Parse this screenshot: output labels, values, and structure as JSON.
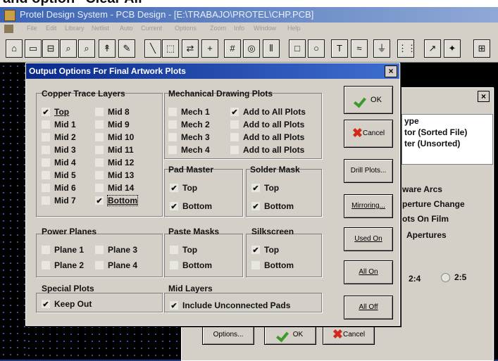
{
  "caption": "and option \"Clear All\"",
  "app": {
    "title": "Protel Design System - PCB Design - [E:\\TRABAJO\\PROTEL\\CHP.PCB]",
    "menu": [
      "File",
      "Edit",
      "Library",
      "Netlist",
      "Auto",
      "Current",
      "Options",
      "Zoom",
      "Info",
      "Window",
      "Help"
    ],
    "toolbar_glyphs": [
      "⌂",
      "▭",
      "⊟",
      "⌕",
      "⌕",
      "↟",
      "✎",
      "╲",
      "⬚",
      "⇄",
      "+",
      "#",
      "◎",
      "⦀",
      "□",
      "○",
      "T",
      "≈",
      "⏚",
      "⋮⋮",
      "↗",
      "✦",
      "⊞"
    ]
  },
  "dialog": {
    "title": "Output Options For Final Artwork Plots",
    "close": "×",
    "copper": {
      "title": "Copper Trace Layers",
      "left": [
        {
          "label": "Top",
          "checked": true
        },
        {
          "label": "Mid 1",
          "checked": false
        },
        {
          "label": "Mid 2",
          "checked": false
        },
        {
          "label": "Mid 3",
          "checked": false
        },
        {
          "label": "Mid 4",
          "checked": false
        },
        {
          "label": "Mid 5",
          "checked": false
        },
        {
          "label": "Mid 6",
          "checked": false
        },
        {
          "label": "Mid 7",
          "checked": false
        }
      ],
      "right": [
        {
          "label": "Mid 8",
          "checked": false
        },
        {
          "label": "Mid 9",
          "checked": false
        },
        {
          "label": "Mid 10",
          "checked": false
        },
        {
          "label": "Mid 11",
          "checked": false
        },
        {
          "label": "Mid 12",
          "checked": false
        },
        {
          "label": "Mid 13",
          "checked": false
        },
        {
          "label": "Mid 14",
          "checked": false
        },
        {
          "label": "Bottom",
          "checked": true
        }
      ]
    },
    "mechanical": {
      "title": "Mechanical Drawing Plots",
      "rows": [
        {
          "mech": "Mech 1",
          "mech_checked": false,
          "add": "Add to All Plots",
          "add_checked": true
        },
        {
          "mech": "Mech 2",
          "mech_checked": false,
          "add": "Add to all Plots",
          "add_checked": false
        },
        {
          "mech": "Mech 3",
          "mech_checked": false,
          "add": "Add to all Plots",
          "add_checked": false
        },
        {
          "mech": "Mech 4",
          "mech_checked": false,
          "add": "Add to all Plots",
          "add_checked": false
        }
      ]
    },
    "pad_master": {
      "title": "Pad Master",
      "items": [
        {
          "label": "Top",
          "checked": true
        },
        {
          "label": "Bottom",
          "checked": true
        }
      ]
    },
    "solder_mask": {
      "title": "Solder Mask",
      "items": [
        {
          "label": "Top",
          "checked": true
        },
        {
          "label": "Bottom",
          "checked": true
        }
      ]
    },
    "power_planes": {
      "title": "Power Planes",
      "items": [
        {
          "label": "Plane 1",
          "checked": false
        },
        {
          "label": "Plane 3",
          "checked": false
        },
        {
          "label": "Plane 2",
          "checked": false
        },
        {
          "label": "Plane 4",
          "checked": false
        }
      ]
    },
    "paste_masks": {
      "title": "Paste Masks",
      "items": [
        {
          "label": "Top",
          "checked": false
        },
        {
          "label": "Bottom",
          "checked": false
        }
      ]
    },
    "silkscreen": {
      "title": "Silkscreen",
      "items": [
        {
          "label": "Top",
          "checked": true
        },
        {
          "label": "Bottom",
          "checked": false
        }
      ]
    },
    "special": {
      "title": "Special Plots",
      "items": [
        {
          "label": "Keep Out",
          "checked": true
        }
      ]
    },
    "mid_layers": {
      "title": "Mid Layers",
      "items": [
        {
          "label": "Include Unconnected Pads",
          "checked": true
        }
      ]
    },
    "buttons": {
      "ok": "OK",
      "cancel": "Cancel",
      "drill": "Drill Plots...",
      "mirroring": "Mirroring...",
      "used_on": "Used On",
      "all_on": "All On",
      "all_off": "All Off"
    }
  },
  "back_dialog": {
    "close": "×",
    "type_header": "ype",
    "type_rows": [
      "tor (Sorted File)",
      "ter (Unsorted)"
    ],
    "options": [
      "ware Arcs",
      "perture Change",
      "ots On Film",
      "Apertures"
    ],
    "ratio_a": "2:4",
    "ratio_b": "2:5",
    "btn_options": "Options...",
    "btn_ok": "OK",
    "btn_cancel": "Cancel"
  }
}
